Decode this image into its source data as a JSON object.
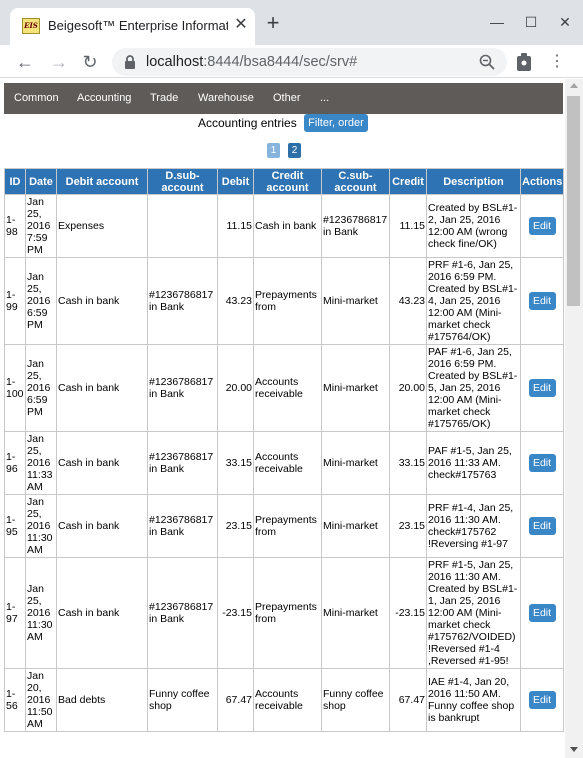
{
  "browser": {
    "tab_title": "Beigesoft™ Enterprise Information",
    "favicon_text": "EIS",
    "close_glyph": "✕",
    "newtab_glyph": "+",
    "url_host": "localhost",
    "url_rest": ":8444/bsa8444/sec/srv#",
    "window_buttons": {
      "minimize": "—",
      "maximize": "☐",
      "close": "✕"
    },
    "nav": {
      "back": "←",
      "forward": "→",
      "reload": "↻",
      "menu": "⋮"
    }
  },
  "navbar": {
    "items": [
      "Common",
      "Accounting",
      "Trade",
      "Warehouse",
      "Other",
      "..."
    ]
  },
  "page": {
    "heading": "Accounting entries",
    "filter_button": "Filter, order",
    "pages": [
      "1",
      "2"
    ]
  },
  "table": {
    "columns": [
      "ID",
      "Date",
      "Debit account",
      "D.sub-account",
      "Debit",
      "Credit account",
      "C.sub-account",
      "Credit",
      "Description",
      "Actions"
    ],
    "edit_label": "Edit",
    "rows": [
      {
        "id": "1-98",
        "date": "Jan 25, 2016 7:59 PM",
        "debit_account": "Expenses",
        "d_sub": "",
        "debit": "11.15",
        "credit_account": "Cash in bank",
        "c_sub": "#1236786817 in Bank",
        "credit": "11.15",
        "description": "Created by BSL#1-2, Jan 25, 2016 12:00 AM (wrong check fine/OK)"
      },
      {
        "id": "1-99",
        "date": "Jan 25, 2016 6:59 PM",
        "debit_account": "Cash in bank",
        "d_sub": "#1236786817 in Bank",
        "debit": "43.23",
        "credit_account": "Prepayments from",
        "c_sub": "Mini-market",
        "credit": "43.23",
        "description": "PRF #1-6, Jan 25, 2016 6:59 PM. Created by BSL#1-4, Jan 25, 2016 12:00 AM (Mini-market check #175764/OK)"
      },
      {
        "id": "1-100",
        "date": "Jan 25, 2016 6:59 PM",
        "debit_account": "Cash in bank",
        "d_sub": "#1236786817 in Bank",
        "debit": "20.00",
        "credit_account": "Accounts receivable",
        "c_sub": "Mini-market",
        "credit": "20.00",
        "description": "PAF #1-6, Jan 25, 2016 6:59 PM. Created by BSL#1-5, Jan 25, 2016 12:00 AM (Mini-market check #175765/OK)"
      },
      {
        "id": "1-96",
        "date": "Jan 25, 2016 11:33 AM",
        "debit_account": "Cash in bank",
        "d_sub": "#1236786817 in Bank",
        "debit": "33.15",
        "credit_account": "Accounts receivable",
        "c_sub": "Mini-market",
        "credit": "33.15",
        "description": "PAF #1-5, Jan 25, 2016 11:33 AM. check#175763"
      },
      {
        "id": "1-95",
        "date": "Jan 25, 2016 11:30 AM",
        "debit_account": "Cash in bank",
        "d_sub": "#1236786817 in Bank",
        "debit": "23.15",
        "credit_account": "Prepayments from",
        "c_sub": "Mini-market",
        "credit": "23.15",
        "description": "PRF #1-4, Jan 25, 2016 11:30 AM. check#175762 !Reversing #1-97"
      },
      {
        "id": "1-97",
        "date": "Jan 25, 2016 11:30 AM",
        "debit_account": "Cash in bank",
        "d_sub": "#1236786817 in Bank",
        "debit": "-23.15",
        "credit_account": "Prepayments from",
        "c_sub": "Mini-market",
        "credit": "-23.15",
        "description": "PRF #1-5, Jan 25, 2016 11:30 AM. Created by BSL#1-1, Jan 25, 2016 12:00 AM (Mini-market check #175762/VOIDED) !Reversed #1-4 ,Reversed #1-95!"
      },
      {
        "id": "1-56",
        "date": "Jan 20, 2016 11:50 AM",
        "debit_account": "Bad debts",
        "d_sub": "Funny coffee shop",
        "debit": "67.47",
        "credit_account": "Accounts receivable",
        "c_sub": "Funny coffee shop",
        "credit": "67.47",
        "description": "IAE #1-4, Jan 20, 2016 11:50 AM. Funny coffee shop is bankrupt"
      }
    ]
  }
}
